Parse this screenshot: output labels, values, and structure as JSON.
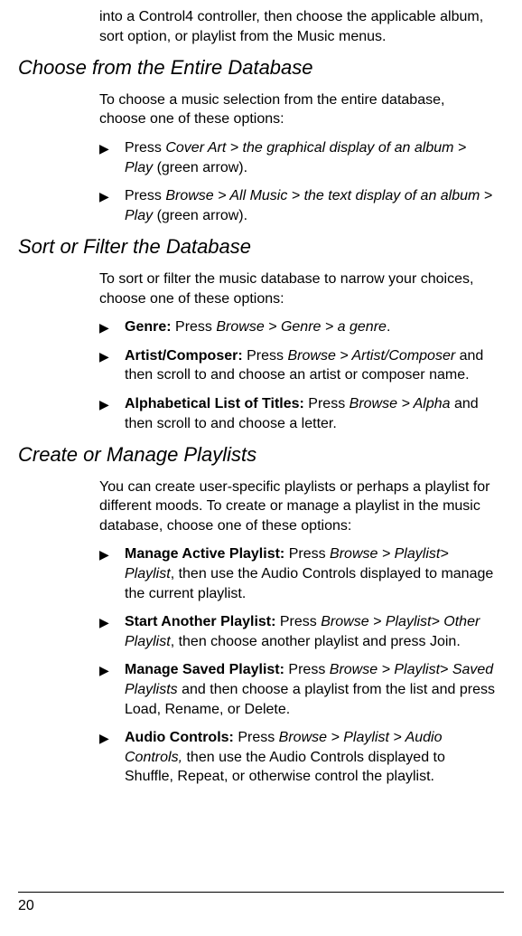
{
  "intro_continuation": {
    "pre": "into a Control4 controller, then choose the applicable album, sort option, or playlist from the Music menus."
  },
  "section1": {
    "heading": "Choose from the Entire Database",
    "lead": "To choose a music selection from the entire database, choose one of these options:",
    "items": [
      {
        "pre": "Press ",
        "path": "Cover Art > the graphical display of an album > Play",
        "post": " (green arrow)."
      },
      {
        "pre": "Press ",
        "path": "Browse > All Music > the text display of an album > Play",
        "post": " (green arrow)."
      }
    ]
  },
  "section2": {
    "heading": "Sort or Filter the Database",
    "lead": "To sort or filter the music database to narrow your choices, choose one of these options:",
    "items": [
      {
        "label": "Genre:",
        "pre": " Press ",
        "path": "Browse > Genre > a genre",
        "post": "."
      },
      {
        "label": "Artist/Composer:",
        "pre": " Press ",
        "path": "Browse > Artist/Composer",
        "post": " and then scroll to and choose an artist or composer name."
      },
      {
        "label": "Alphabetical List of Titles:",
        "pre": " Press ",
        "path": "Browse > Alpha",
        "post": " and then scroll to and choose a letter."
      }
    ]
  },
  "section3": {
    "heading": "Create or Manage Playlists",
    "lead": "You can create user-specific playlists or perhaps a playlist for different moods. To create or manage a playlist in the music database, choose one of these options:",
    "items": [
      {
        "label": "Manage Active Playlist:",
        "pre": " Press ",
        "path": "Browse > Playlist> Playlist",
        "post": ", then use the Audio Controls displayed to manage the current playlist."
      },
      {
        "label": "Start Another Playlist:",
        "pre": " Press ",
        "path": "Browse > Playlist> Other Playlist",
        "post": ", then choose another playlist and press Join."
      },
      {
        "label": "Manage Saved Playlist:",
        "pre": " Press ",
        "path": "Browse > Playlist> Saved Playlists",
        "post": " and then choose a playlist from the list and press Load, Rename, or Delete."
      },
      {
        "label": "Audio Controls:",
        "pre": " Press ",
        "path": "Browse > Playlist > Audio Controls,",
        "post": " then use the Audio Controls displayed to Shuffle, Repeat, or otherwise control the playlist."
      }
    ]
  },
  "page_number": "20",
  "bullet_glyph": "▶"
}
